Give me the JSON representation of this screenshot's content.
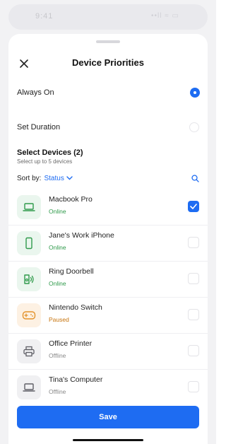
{
  "status_bar": {
    "time": "9:41",
    "indicators": "••ll ≈ ▭"
  },
  "header": {
    "title": "Device Priorities",
    "close_icon": "close-icon"
  },
  "options": [
    {
      "label": "Always On",
      "selected": true
    },
    {
      "label": "Set Duration",
      "selected": false
    }
  ],
  "select_devices": {
    "title": "Select Devices (2)",
    "subtitle": "Select up to 5 devices",
    "sort_label": "Sort by:",
    "sort_value": "Status"
  },
  "devices": [
    {
      "name": "Macbook Pro",
      "status": "Online",
      "state": "online",
      "icon": "laptop-icon",
      "checked": true
    },
    {
      "name": "Jane's Work iPhone",
      "status": "Online",
      "state": "online",
      "icon": "phone-icon",
      "checked": false
    },
    {
      "name": "Ring Doorbell",
      "status": "Online",
      "state": "online",
      "icon": "doorbell-icon",
      "checked": false
    },
    {
      "name": "Nintendo Switch",
      "status": "Paused",
      "state": "paused",
      "icon": "gamepad-icon",
      "checked": false
    },
    {
      "name": "Office Printer",
      "status": "Offline",
      "state": "offline",
      "icon": "printer-icon",
      "checked": false
    },
    {
      "name": "Tina's Computer",
      "status": "Offline",
      "state": "offline",
      "icon": "laptop-icon",
      "checked": false
    }
  ],
  "save_label": "Save",
  "colors": {
    "accent": "#1e6cf2",
    "online": "#2f9a4b",
    "paused": "#c7740d",
    "offline": "#8a8a8a"
  }
}
